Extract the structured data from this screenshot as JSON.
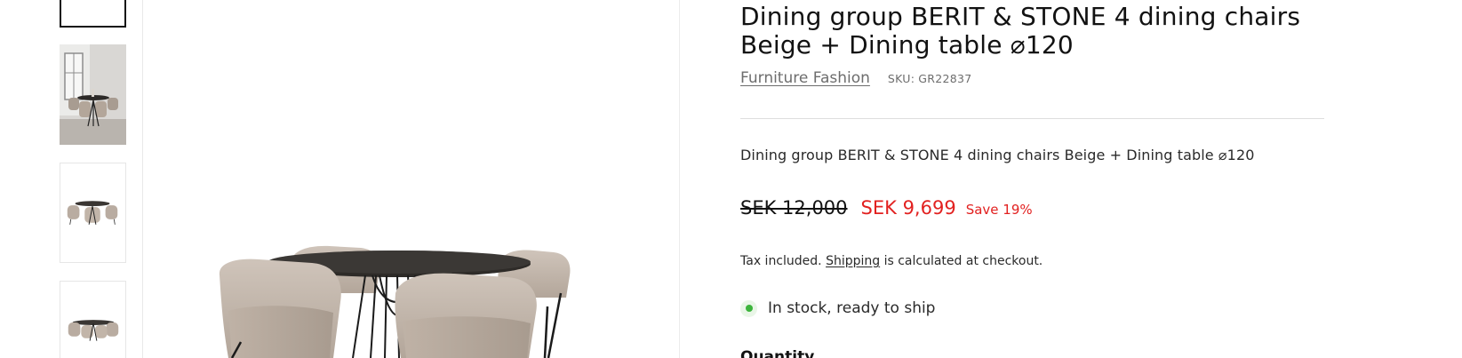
{
  "product": {
    "title": "Dining group BERIT & STONE 4 dining chairs Beige + Dining table ⌀120",
    "vendor": "Furniture Fashion",
    "sku_label": "SKU:",
    "sku_value": "GR22837",
    "description": "Dining group BERIT & STONE 4 dining chairs Beige + Dining table ⌀120"
  },
  "price": {
    "compare_at": "SEK 12,000",
    "sale": "SEK 9,699",
    "save_badge": "Save 19%",
    "sale_color": "#e22120"
  },
  "tax_note": {
    "prefix": "Tax included.",
    "link": "Shipping",
    "suffix": "is calculated at checkout."
  },
  "inventory": {
    "status_text": "In stock, ready to ship",
    "status_color": "#3cb43c"
  },
  "quantity": {
    "label": "Quantity"
  },
  "gallery": {
    "thumbnails": [
      {
        "icon": "product-thumbnail-blank",
        "active": true
      },
      {
        "icon": "room-scene-thumbnail",
        "active": false
      },
      {
        "icon": "dining-set-thumbnail",
        "active": false
      },
      {
        "icon": "dining-set-angle-thumbnail",
        "active": false
      }
    ],
    "main_image_icon": "dining-set-product-image"
  }
}
